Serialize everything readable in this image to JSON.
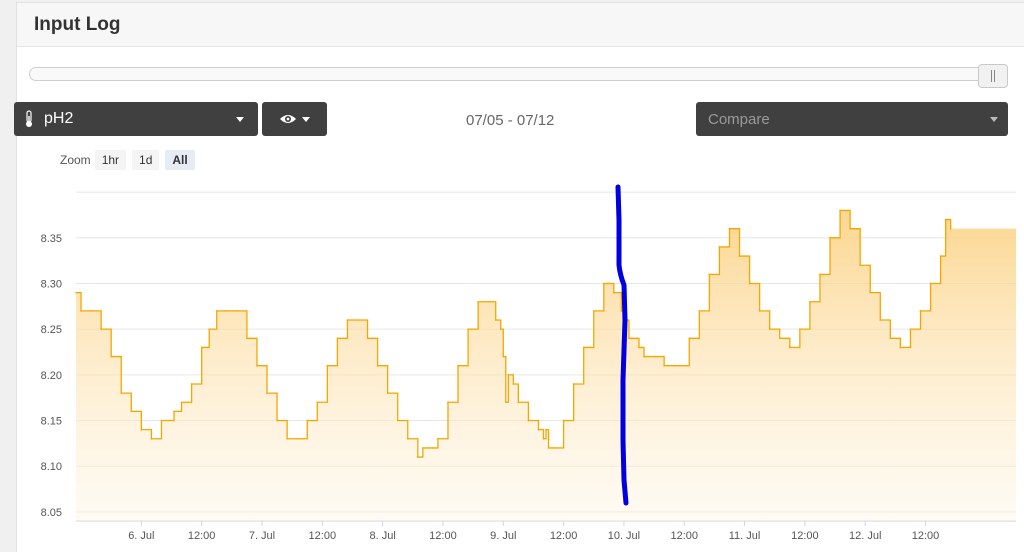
{
  "header": {
    "title": "Input Log"
  },
  "sensor_select": {
    "icon": "thermometer-icon",
    "value": "pH2"
  },
  "view_toggle": {
    "icon": "eye-icon"
  },
  "date_range": "07/05 - 07/12",
  "compare": {
    "placeholder": "Compare"
  },
  "zoom": {
    "label": "Zoom",
    "buttons": [
      "1hr",
      "1d",
      "All"
    ],
    "active": "All"
  },
  "colors": {
    "series": "#f5a700",
    "fill_top": "#fbcf7c",
    "annotation": "#0000e0"
  },
  "chart_data": {
    "type": "area",
    "title": "",
    "xlabel": "",
    "ylabel": "",
    "ylim": [
      8.04,
      8.41
    ],
    "xlim_hours": [
      -13,
      174
    ],
    "y_ticks": [
      8.05,
      8.1,
      8.15,
      8.2,
      8.25,
      8.3,
      8.35
    ],
    "y_tick_labels": [
      "8.05",
      "8.10",
      "8.15",
      "8.20",
      "8.25",
      "8.30",
      "8.35"
    ],
    "x_ticks": [
      "6. Jul",
      "12:00",
      "7. Jul",
      "12:00",
      "8. Jul",
      "12:00",
      "9. Jul",
      "12:00",
      "10. Jul",
      "12:00",
      "11. Jul",
      "12:00",
      "12. Jul",
      "12:00"
    ],
    "x_tick_hours": [
      0,
      12,
      24,
      36,
      48,
      60,
      72,
      84,
      96,
      108,
      120,
      132,
      144,
      156
    ],
    "grid": true,
    "series": [
      {
        "x_hours": [
          -13,
          -12,
          -10,
          -8,
          -6,
          -4,
          -2,
          0,
          2,
          4,
          5.5,
          6.5,
          8,
          10,
          12,
          13.5,
          15,
          17,
          19,
          21,
          23,
          25,
          27,
          29,
          31,
          32,
          33,
          35,
          37,
          39,
          41,
          43,
          45,
          47,
          49,
          51,
          53,
          55,
          56,
          57,
          58,
          59,
          61,
          63,
          65,
          67,
          69,
          70.5,
          71.5,
          72,
          72.5,
          73,
          74,
          75,
          77,
          79,
          80,
          80.5,
          81,
          82,
          84,
          86,
          88,
          90,
          92,
          92.5,
          93,
          94,
          95.5,
          96,
          97,
          99,
          100,
          102,
          104,
          106,
          107,
          109,
          111,
          113,
          115,
          117,
          119,
          121,
          123,
          125,
          127,
          129,
          131,
          133,
          135,
          137,
          139,
          141,
          143,
          145,
          147,
          149,
          151,
          153,
          155,
          157,
          159,
          160,
          161
        ],
        "y": [
          8.29,
          8.27,
          8.27,
          8.25,
          8.22,
          8.18,
          8.16,
          8.14,
          8.13,
          8.15,
          8.15,
          8.16,
          8.17,
          8.19,
          8.23,
          8.25,
          8.27,
          8.27,
          8.27,
          8.24,
          8.21,
          8.18,
          8.15,
          8.13,
          8.13,
          8.13,
          8.15,
          8.17,
          8.21,
          8.24,
          8.26,
          8.26,
          8.24,
          8.21,
          8.18,
          8.15,
          8.13,
          8.11,
          8.12,
          8.12,
          8.12,
          8.13,
          8.17,
          8.21,
          8.25,
          8.28,
          8.28,
          8.26,
          8.25,
          8.22,
          8.17,
          8.2,
          8.19,
          8.17,
          8.15,
          8.14,
          8.13,
          8.14,
          8.12,
          8.12,
          8.15,
          8.19,
          8.23,
          8.27,
          8.3,
          8.3,
          8.3,
          8.29,
          8.27,
          8.26,
          8.24,
          8.23,
          8.22,
          8.22,
          8.21,
          8.21,
          8.21,
          8.24,
          8.27,
          8.31,
          8.34,
          8.36,
          8.33,
          8.3,
          8.27,
          8.25,
          8.24,
          8.23,
          8.25,
          8.28,
          8.31,
          8.35,
          8.38,
          8.36,
          8.32,
          8.29,
          8.26,
          8.24,
          8.23,
          8.25,
          8.27,
          8.3,
          8.33,
          8.37,
          8.36
        ]
      }
    ]
  }
}
